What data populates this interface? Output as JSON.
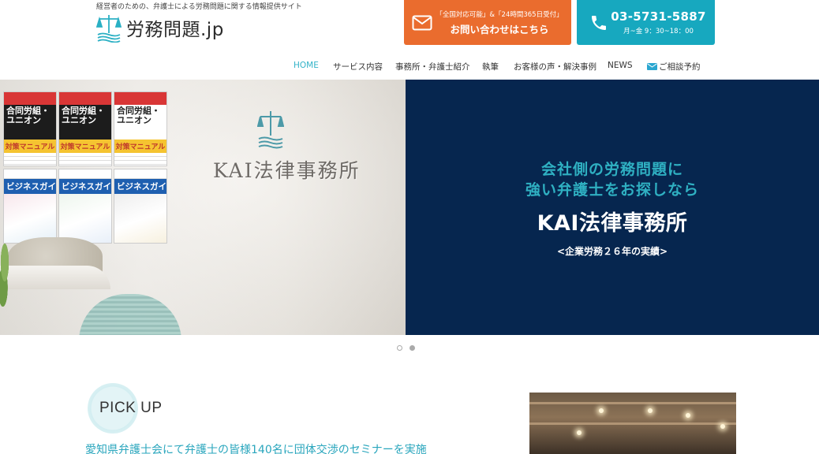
{
  "header": {
    "tagline": "経営者のための、弁護士による労務問題に関する情報提供サイト",
    "logo_text": "労務問題.jp",
    "contact": {
      "small": "「全国対応可能」&「24時間365日受付」",
      "main": "お問い合わせはこちら"
    },
    "phone": {
      "number": "03-5731-5887",
      "hours": "月~金 9：30~18：00"
    }
  },
  "nav": {
    "items": [
      {
        "label": "HOME",
        "active": true
      },
      {
        "label": "サービス内容"
      },
      {
        "label": "事務所・弁護士紹介"
      },
      {
        "label": "執筆"
      },
      {
        "label": "お客様の声・解決事例"
      },
      {
        "label": "NEWS"
      },
      {
        "label": "ご相談予約"
      }
    ]
  },
  "hero": {
    "sign": "KAI法律事務所",
    "magazines": {
      "union_title": "合同労組・ユニオン",
      "union_sub": "対策マニュアル",
      "biz_title": "ビジネスガイド"
    },
    "panel": {
      "line1": "会社側の労務問題に",
      "line2": "強い弁護士をお探しなら",
      "line3": "KAI法律事務所",
      "line4": "<企業労務２６年の実績>"
    },
    "slides": {
      "count": 2,
      "active": 2
    }
  },
  "pickup": {
    "label": "PICK UP",
    "title": "愛知県弁護士会にて弁護士の皆様140名に団体交渉のセミナーを実施"
  },
  "colors": {
    "orange": "#ea6c2e",
    "teal": "#17a8bf",
    "navy": "#06264f",
    "accent_text": "#2fb0c2"
  }
}
